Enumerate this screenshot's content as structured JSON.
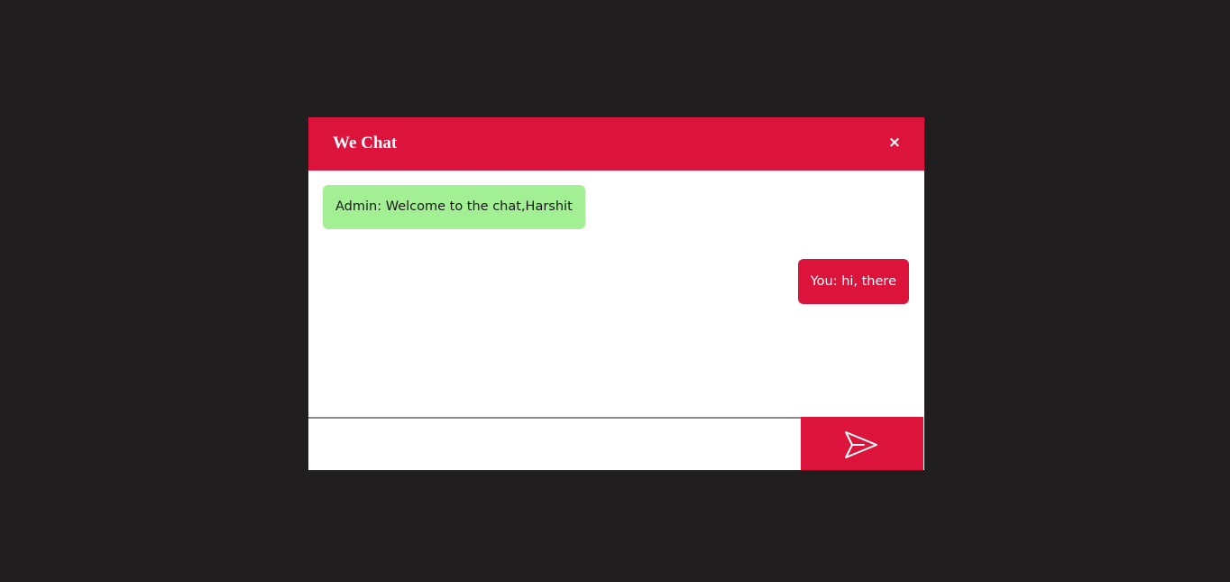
{
  "header": {
    "title": "We Chat",
    "close_label": "×"
  },
  "messages": [
    {
      "sender": "admin",
      "text": "Admin: Welcome to the chat,Harshit"
    },
    {
      "sender": "you",
      "text": "You: hi, there"
    }
  ],
  "composer": {
    "input_value": "",
    "input_placeholder": "",
    "send_icon": "send-icon"
  },
  "colors": {
    "background": "#201e1f",
    "accent": "#dc143c",
    "admin_bubble": "#a2ef94",
    "window": "#ffffff"
  }
}
